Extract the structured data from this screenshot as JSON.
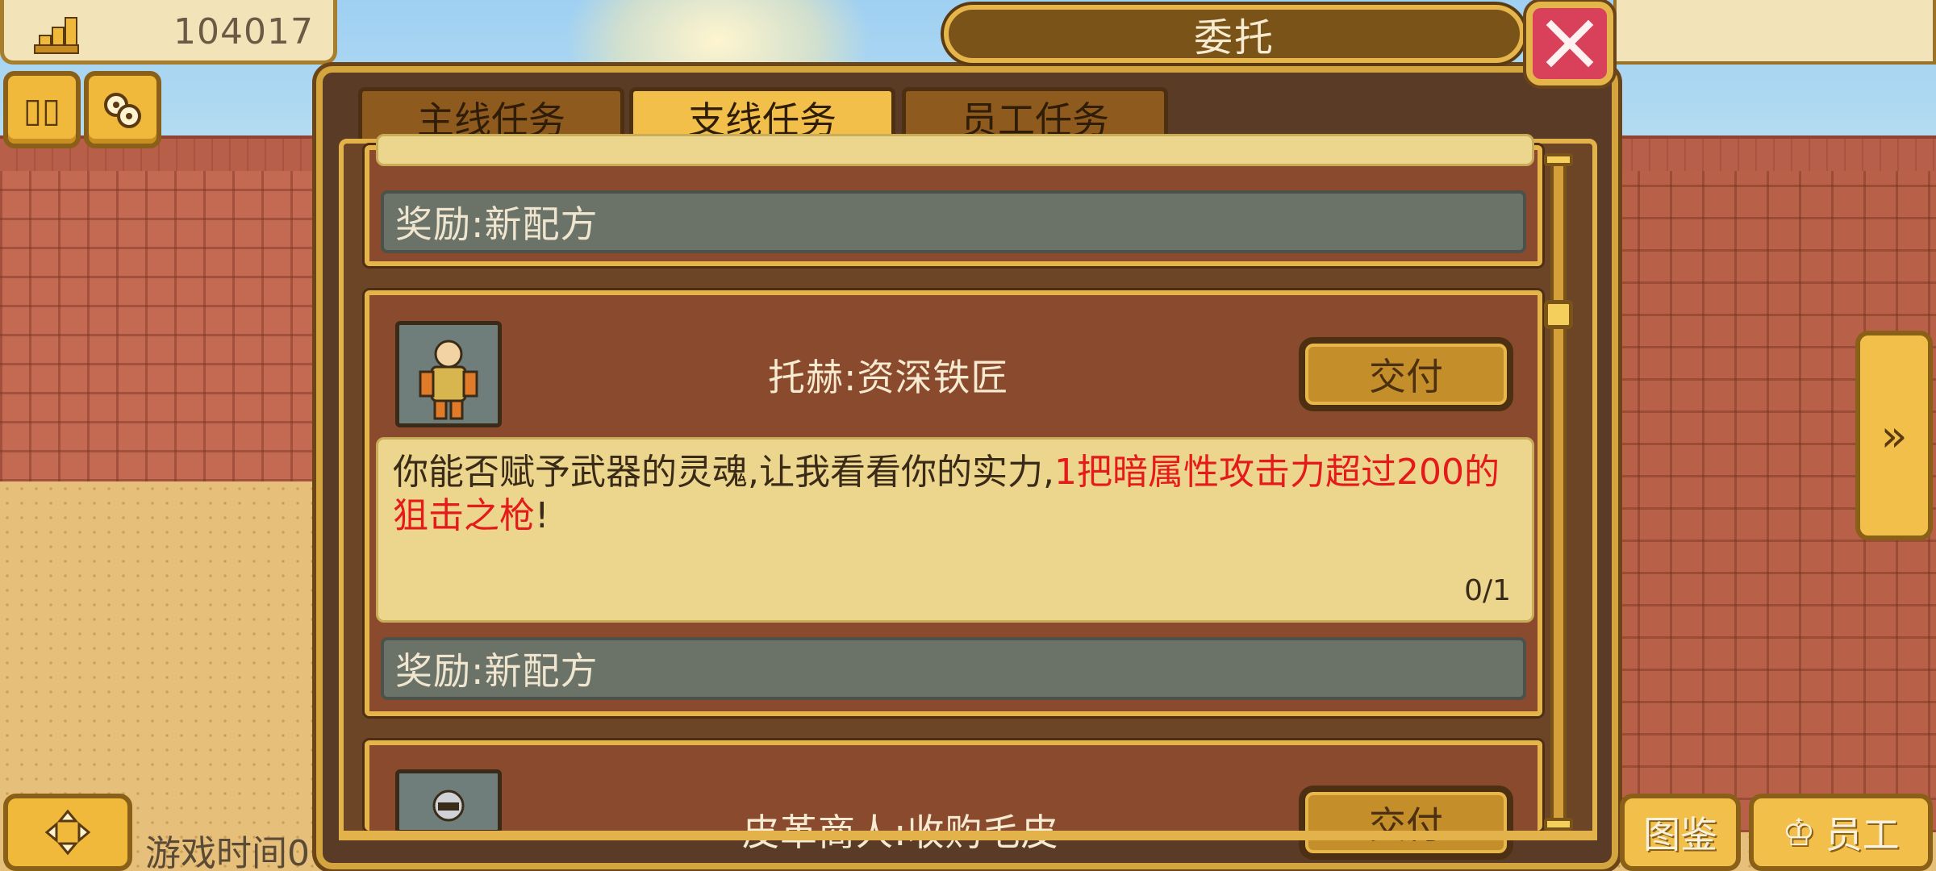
{
  "hud": {
    "gold_value": "104017",
    "game_time_label": "游戏时间0"
  },
  "dialog": {
    "title": "委托",
    "tabs": [
      {
        "label": "主线任务",
        "active": false
      },
      {
        "label": "支线任务",
        "active": true
      },
      {
        "label": "员工任务",
        "active": false
      }
    ]
  },
  "quests": [
    {
      "reward": "奖励:新配方"
    },
    {
      "name": "托赫:资深铁匠",
      "deliver_label": "交付",
      "desc_prefix": "你能否赋予武器的灵魂,让我看看你的实力,",
      "desc_highlight": "1把暗属性攻击力超过200的狙击之枪",
      "desc_suffix": "!",
      "progress": "0/1",
      "reward": "奖励:新配方"
    },
    {
      "name": "皮革商人:收购毛皮",
      "deliver_label": "交付"
    }
  ],
  "bottom_buttons": {
    "codex_label": "图鉴",
    "staff_label": "员工"
  },
  "colors": {
    "panel_border": "#d4a43f",
    "active_tab": "#f2c04a",
    "highlight_text": "#e51a1a",
    "close_button": "#d9415a"
  }
}
